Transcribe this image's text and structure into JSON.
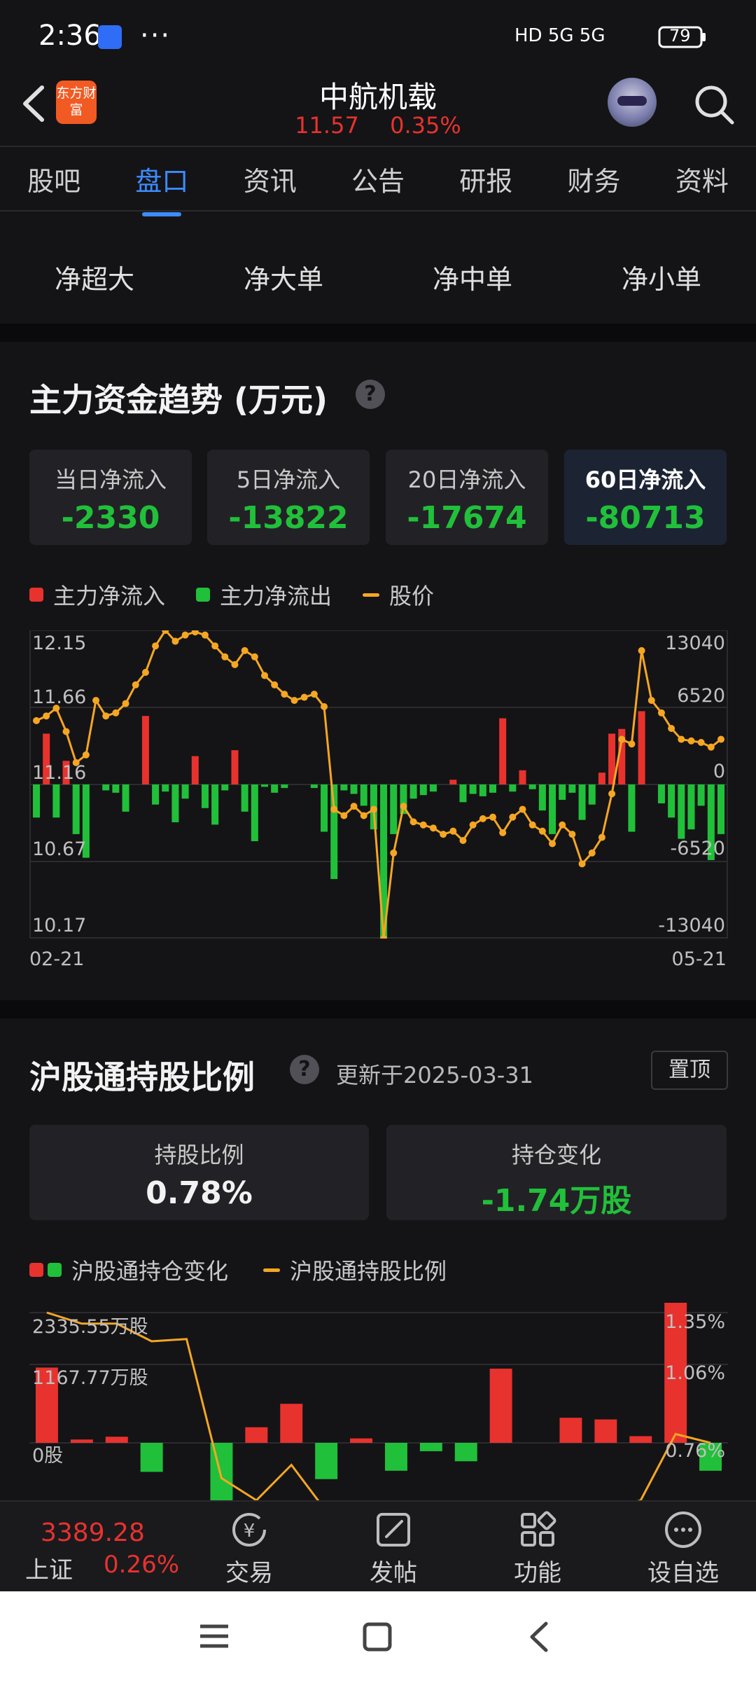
{
  "status_bar": {
    "time": "2:36",
    "more": "···",
    "network": "HD 5G 5G",
    "battery": "79"
  },
  "header": {
    "logo_text": "东方财富",
    "stock_name": "中航机载",
    "price": "11.57",
    "change": "0.35%"
  },
  "tabs": [
    "股吧",
    "盘口",
    "资讯",
    "公告",
    "研报",
    "财务",
    "资料"
  ],
  "active_tab": "盘口",
  "net_filters": [
    "净超大",
    "净大单",
    "净中单",
    "净小单"
  ],
  "fund_trend": {
    "title": "主力资金趋势 (万元)",
    "cards": [
      {
        "label": "当日净流入",
        "value": "-2330"
      },
      {
        "label": "5日净流入",
        "value": "-13822"
      },
      {
        "label": "20日净流入",
        "value": "-17674"
      },
      {
        "label": "60日净流入",
        "value": "-80713"
      }
    ],
    "legend": [
      "主力净流入",
      "主力净流出",
      "股价"
    ],
    "start_date": "02-21",
    "end_date": "05-21"
  },
  "hk_connect": {
    "title": "沪股通持股比例",
    "updated": "更新于2025-03-31",
    "pin_label": "置顶",
    "ratio_label": "持股比例",
    "ratio_value": "0.78%",
    "change_label": "持仓变化",
    "change_value": "-1.74万股",
    "legend": [
      "沪股通持仓变化",
      "沪股通持股比例"
    ]
  },
  "bottom_nav": {
    "index_value": "3389.28",
    "index_name": "上证",
    "index_change": "0.26%",
    "items": [
      "交易",
      "发帖",
      "功能",
      "设自选"
    ]
  },
  "colors": {
    "up": "#e8322e",
    "down": "#21c03a",
    "price_line": "#f5a623",
    "accent": "#3d8bff"
  },
  "chart_data": [
    {
      "type": "bar+line",
      "title": "主力资金趋势 (万元)",
      "x_start": "02-21",
      "x_end": "05-21",
      "y_left_ticks": [
        "12.15",
        "11.66",
        "11.16",
        "10.67",
        "10.17"
      ],
      "y_right_ticks": [
        "13040",
        "6520",
        "0",
        "-6520",
        "-13040"
      ],
      "y_left_range": [
        10.17,
        12.15
      ],
      "y_right_range": [
        -13040,
        13040
      ],
      "series": [
        {
          "name": "股价",
          "values": [
            11.57,
            11.6,
            11.65,
            11.5,
            11.3,
            11.35,
            11.7,
            11.6,
            11.62,
            11.68,
            11.8,
            11.88,
            12.05,
            12.15,
            12.08,
            12.12,
            12.14,
            12.12,
            12.05,
            11.98,
            11.93,
            12.02,
            11.98,
            11.86,
            11.8,
            11.74,
            11.7,
            11.72,
            11.74,
            11.66,
            11.0,
            10.96,
            11.02,
            10.96,
            11.0,
            10.17,
            10.72,
            11.02,
            10.92,
            10.9,
            10.88,
            10.84,
            10.86,
            10.8,
            10.9,
            10.94,
            10.95,
            10.85,
            10.95,
            11.0,
            10.9,
            10.86,
            10.78,
            10.9,
            10.84,
            10.65,
            10.72,
            10.82,
            11.1,
            11.45,
            11.42,
            12.02,
            11.7,
            11.62,
            11.52,
            11.45,
            11.44,
            11.43,
            11.4,
            11.45
          ]
        },
        {
          "name": "主力净流入",
          "values": [
            -2800,
            4300,
            -2800,
            2000,
            -4200,
            -6200,
            0,
            -500,
            -700,
            -2300,
            0,
            5800,
            -1700,
            -600,
            -3200,
            -1200,
            2400,
            -2000,
            -3400,
            -500,
            2900,
            -2300,
            -4800,
            -200,
            -700,
            -300,
            0,
            0,
            -300,
            -4000,
            -8000,
            -500,
            -800,
            -1800,
            -3800,
            -13000,
            -4200,
            -2500,
            -1200,
            -900,
            -600,
            0,
            400,
            -1500,
            -800,
            -1000,
            -700,
            5600,
            -600,
            1200,
            -400,
            -2200,
            -4200,
            -1300,
            -700,
            -3000,
            -1700,
            1000,
            4300,
            4700,
            -4000,
            6200,
            0,
            -1600,
            -2800,
            -4600,
            -3800,
            -1800,
            -6400,
            -4200
          ]
        }
      ]
    },
    {
      "type": "bar+line",
      "title": "沪股通持股比例",
      "y_left_ticks": [
        "2335.55万股",
        "1167.77万股",
        "0股"
      ],
      "y_right_ticks": [
        "1.35%",
        "1.06%",
        "0.76%"
      ],
      "series": [
        {
          "name": "沪股通持仓变化",
          "values": [
            1350,
            60,
            110,
            -520,
            0,
            -1150,
            280,
            700,
            -650,
            80,
            -500,
            -150,
            -330,
            1330,
            0,
            450,
            420,
            120,
            3100,
            -500
          ]
        },
        {
          "name": "沪股通持股比例",
          "values": [
            1.35,
            1.3,
            1.3,
            1.22,
            1.23,
            0.6,
            0.5,
            0.66,
            0.45,
            0.45,
            0.45,
            0.45,
            0.45,
            0.45,
            0.45,
            0.45,
            0.45,
            0.5,
            0.8,
            0.76
          ]
        }
      ]
    }
  ]
}
